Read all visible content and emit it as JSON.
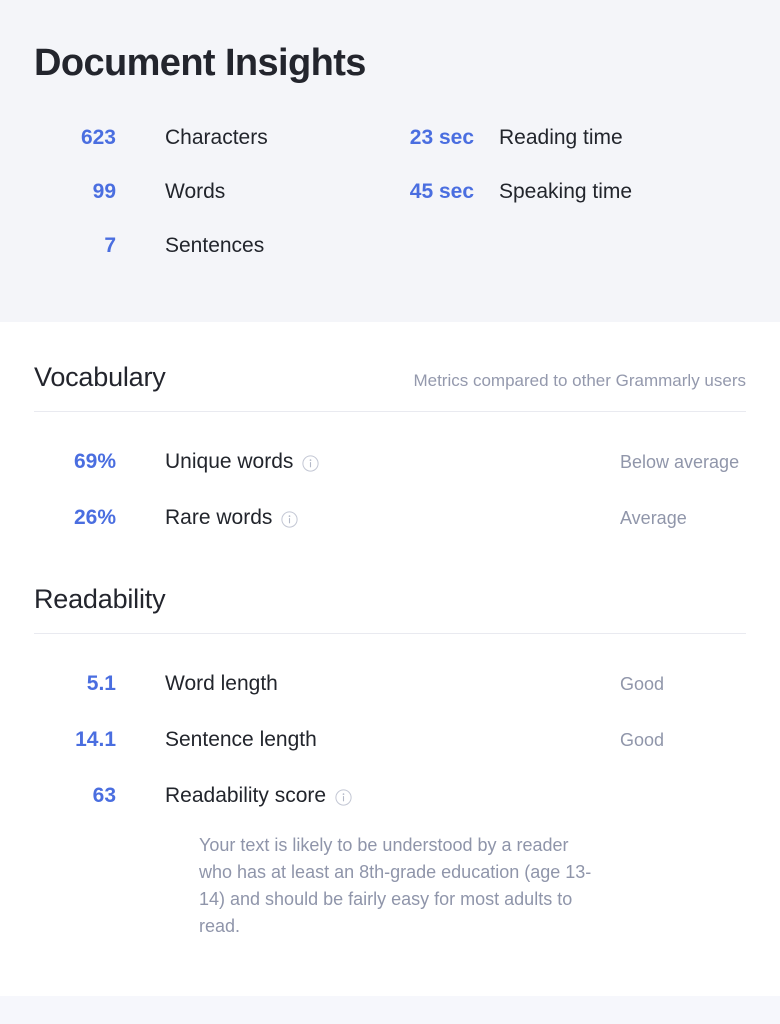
{
  "header": {
    "title": "Document Insights",
    "stats_left": [
      {
        "value": "623",
        "label": "Characters"
      },
      {
        "value": "99",
        "label": "Words"
      },
      {
        "value": "7",
        "label": "Sentences"
      }
    ],
    "stats_right": [
      {
        "value": "23 sec",
        "label": "Reading time"
      },
      {
        "value": "45 sec",
        "label": "Speaking time"
      }
    ]
  },
  "vocabulary": {
    "title": "Vocabulary",
    "note": "Metrics compared to other Grammarly users",
    "metrics": [
      {
        "value": "69%",
        "label": "Unique words",
        "has_info": true,
        "bar_percent": 47,
        "status": "Below average"
      },
      {
        "value": "26%",
        "label": "Rare words",
        "has_info": true,
        "bar_percent": 61,
        "status": "Average"
      }
    ]
  },
  "readability": {
    "title": "Readability",
    "metrics": [
      {
        "value": "5.1",
        "label": "Word length",
        "has_info": false,
        "bar_percent": 82,
        "status": "Good"
      },
      {
        "value": "14.1",
        "label": "Sentence length",
        "has_info": false,
        "bar_percent": 92,
        "status": "Good"
      },
      {
        "value": "63",
        "label": "Readability score",
        "has_info": true,
        "bar_percent": null,
        "status": ""
      }
    ],
    "note": "Your text is likely to be understood by a reader who has at least an 8th-grade education (age 13-14) and should be fairly easy for most adults to read."
  },
  "colors": {
    "accent_blue": "#4a6ee0",
    "header_bg": "#f4f5f9",
    "muted_text": "#9096aa",
    "track": "#eef0f4"
  }
}
